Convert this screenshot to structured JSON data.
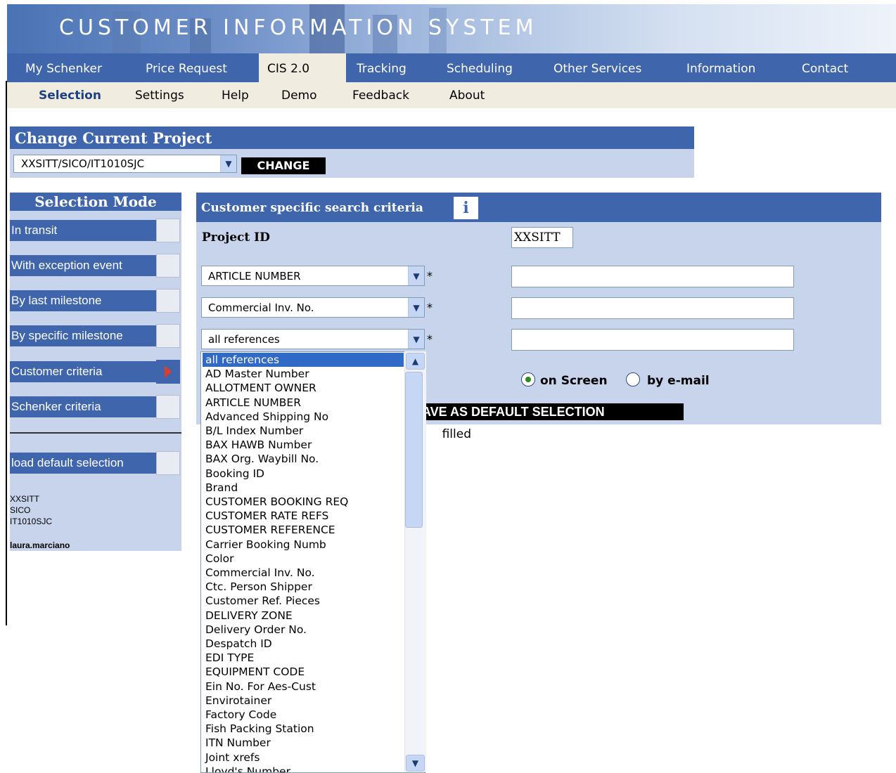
{
  "header": {
    "title": "CUSTOMER INFORMATION SYSTEM"
  },
  "main_nav": {
    "items": [
      {
        "label": "My Schenker"
      },
      {
        "label": "Price Request"
      },
      {
        "label": "CIS 2.0"
      },
      {
        "label": "Tracking"
      },
      {
        "label": "Scheduling"
      },
      {
        "label": "Other Services"
      },
      {
        "label": "Information"
      },
      {
        "label": "Contact"
      }
    ],
    "active": "CIS 2.0"
  },
  "sub_nav": {
    "items": [
      {
        "label": "Selection"
      },
      {
        "label": "Settings"
      },
      {
        "label": "Help"
      },
      {
        "label": "Demo"
      },
      {
        "label": "Feedback"
      },
      {
        "label": "About"
      }
    ],
    "active": "Selection"
  },
  "change_project": {
    "title": "Change Current Project",
    "selected_project": "XXSITT/SICO/IT1010SJC",
    "change_button": "CHANGE"
  },
  "selection_mode": {
    "title": "Selection Mode",
    "items": [
      {
        "label": "In transit"
      },
      {
        "label": "With exception event"
      },
      {
        "label": "By last milestone"
      },
      {
        "label": "By specific milestone"
      },
      {
        "label": "Customer criteria"
      },
      {
        "label": "Schenker criteria"
      }
    ],
    "active": "Customer criteria",
    "load_default": "load default selection",
    "info_lines": [
      "XXSITT",
      "SICO",
      "IT1010SJC"
    ],
    "user": "laura.marciano"
  },
  "search_criteria": {
    "title": "Customer specific search criteria",
    "info_icon": "i",
    "project_id_label": "Project ID",
    "project_id_value": "XXSITT",
    "fields": [
      {
        "select": "ARTICLE NUMBER",
        "required": "*",
        "value": ""
      },
      {
        "select": "Commercial Inv. No.",
        "required": "*",
        "value": ""
      },
      {
        "select": "all references",
        "required": "*",
        "value": ""
      }
    ],
    "output_options": [
      {
        "label": "on Screen",
        "selected": true
      },
      {
        "label": "by e-mail",
        "selected": false
      }
    ],
    "save_default_button_visible": "AVE AS DEFAULT SELECTION",
    "note_visible": "filled"
  },
  "dropdown_options": [
    "all references",
    "AD Master Number",
    "ALLOTMENT OWNER",
    "ARTICLE NUMBER",
    "Advanced Shipping No",
    "B/L Index Number",
    "BAX HAWB Number",
    "BAX Org. Waybill No.",
    "Booking ID",
    "Brand",
    "CUSTOMER BOOKING REQ",
    "CUSTOMER RATE REFS",
    "CUSTOMER REFERENCE",
    "Carrier Booking Numb",
    "Color",
    "Commercial Inv. No.",
    "Ctc. Person Shipper",
    "Customer Ref. Pieces",
    "DELIVERY ZONE",
    "Delivery Order No.",
    "Despatch ID",
    "EDI TYPE",
    "EQUIPMENT CODE",
    "Ein No. For Aes-Cust",
    "Envirotainer",
    "Factory Code",
    "Fish Packing Station",
    "ITN Number",
    "Joint xrefs",
    "Lloyd's Number"
  ],
  "icons": {
    "select_arrow": "chevron-down-icon",
    "scroll_up": "scroll-up-icon",
    "scroll_down": "scroll-down-icon",
    "active_indicator": "red-triangle-icon"
  },
  "colors": {
    "nav_blue": "#3f65ad",
    "panel_light": "#c7d4ec",
    "subnav_bg": "#f0ede0",
    "selected_option": "#3169c6",
    "indicator_red": "#e23b2c"
  }
}
